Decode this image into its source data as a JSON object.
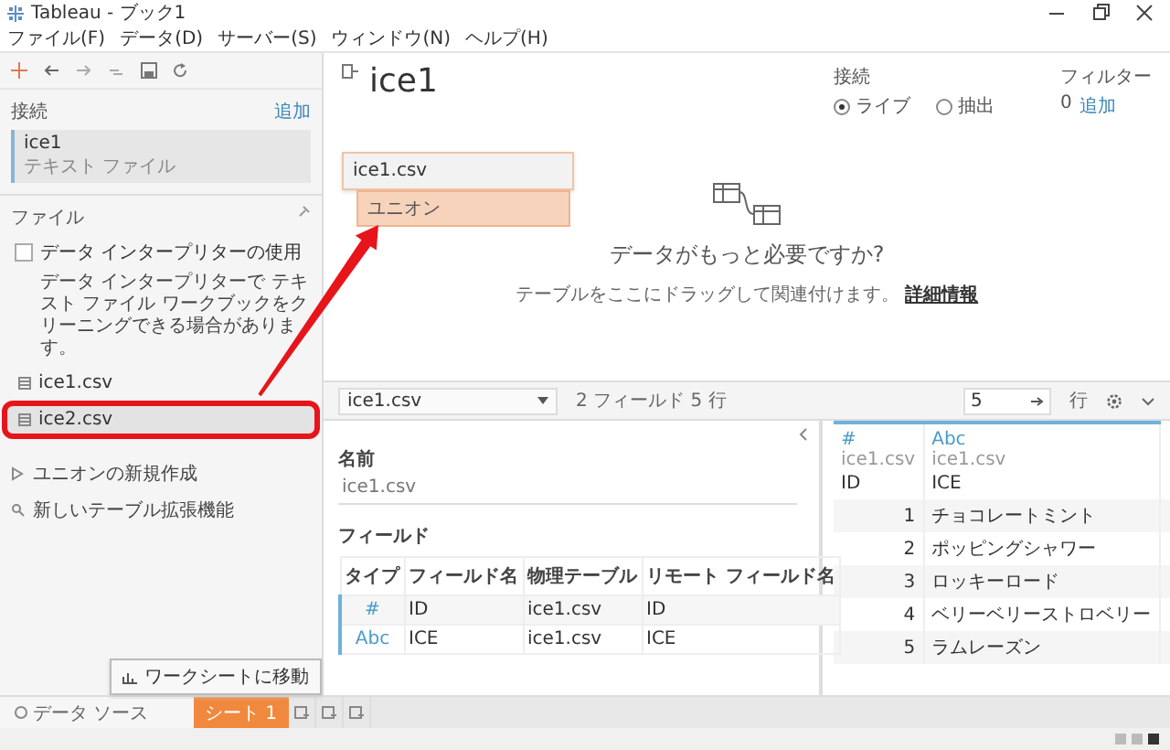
{
  "window": {
    "title": "Tableau - ブック1"
  },
  "menu": [
    "ファイル(F)",
    "データ(D)",
    "サーバー(S)",
    "ウィンドウ(N)",
    "ヘルプ(H)"
  ],
  "sidebar": {
    "connections_label": "接続",
    "add_link": "追加",
    "connections": [
      {
        "name": "ice1",
        "type": "テキスト ファイル",
        "selected": true
      }
    ],
    "files_label": "ファイル",
    "interpreter": {
      "label": "データ インタープリターの使用",
      "checked": false,
      "description": "データ インタープリターで テキスト ファイル ワークブックをクリーニングできる場合があります。"
    },
    "files": [
      {
        "name": "ice1.csv",
        "highlighted": false
      },
      {
        "name": "ice2.csv",
        "highlighted": true
      }
    ],
    "actions": [
      {
        "kind": "union",
        "label": "ユニオンの新規作成"
      },
      {
        "kind": "extension",
        "label": "新しいテーブル拡張機能"
      }
    ]
  },
  "datasource": {
    "name": "ice1",
    "connection_label": "接続",
    "connection_modes": [
      {
        "label": "ライブ",
        "selected": true
      },
      {
        "label": "抽出",
        "selected": false
      }
    ],
    "filters_label": "フィルター",
    "filters_count": "0",
    "filters_add": "追加"
  },
  "canvas": {
    "table": "ice1.csv",
    "union": "ユニオン",
    "union_arrow": true,
    "prompt": "データがもっと必要ですか?",
    "hint": "テーブルをここにドラッグして関連付けます。",
    "hint_link": "詳細情報"
  },
  "toolbar": {
    "table": "ice1.csv",
    "summary": "2 フィールド 5 行",
    "rows_value": "5",
    "rows_label": "行"
  },
  "metadata": {
    "name_label": "名前",
    "name": "ice1.csv",
    "fields_label": "フィールド",
    "columns": [
      "タイプ",
      "フィールド名",
      "物理テーブル",
      "リモート フィールド名"
    ],
    "rows": [
      {
        "type": "#",
        "name": "ID",
        "table": "ice1.csv",
        "remote": "ID"
      },
      {
        "type": "Abc",
        "name": "ICE",
        "table": "ice1.csv",
        "remote": "ICE"
      }
    ]
  },
  "grid": {
    "columns": [
      {
        "type": "#",
        "source": "ice1.csv",
        "name": "ID"
      },
      {
        "type": "Abc",
        "source": "ice1.csv",
        "name": "ICE"
      }
    ],
    "rows": [
      [
        "1",
        "チョコレートミント"
      ],
      [
        "2",
        "ポッピングシャワー"
      ],
      [
        "3",
        "ロッキーロード"
      ],
      [
        "4",
        "ベリーベリーストロベリー"
      ],
      [
        "5",
        "ラムレーズン"
      ]
    ]
  },
  "sheet_tabs": {
    "datasource": "データ ソース",
    "sheets": [
      {
        "label": "シート 1",
        "selected": true
      }
    ]
  },
  "tooltip": "ワークシートに移動"
}
